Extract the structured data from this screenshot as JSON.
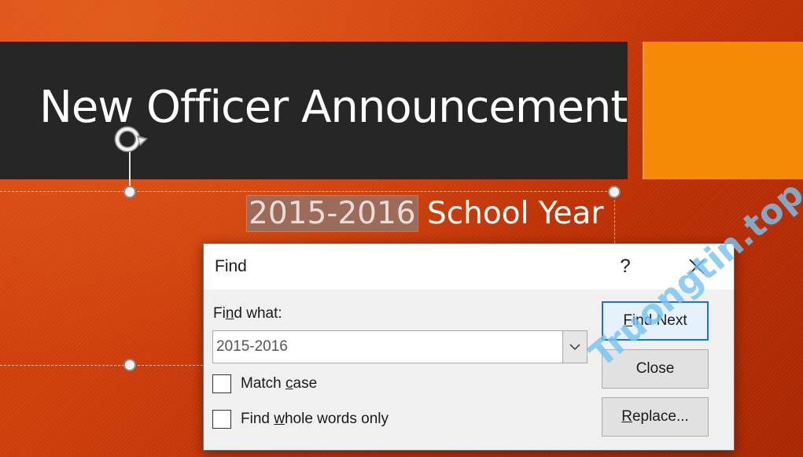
{
  "slide": {
    "title": "New Officer Announcement",
    "subtitle_highlight": "2015-2016",
    "subtitle_rest": " School Year",
    "colors": {
      "background": "#cf3f0c",
      "title_bar": "#262626",
      "accent_block": "#f58a07"
    }
  },
  "dialog": {
    "title": "Find",
    "help_label": "?",
    "close_icon": "close-icon",
    "find_what_label_pre": "Fi",
    "find_what_label_mnemonic": "n",
    "find_what_label_post": "d what:",
    "find_what_value": "2015-2016",
    "dropdown_icon": "chevron-down-icon",
    "match_case_pre": "Match ",
    "match_case_mnemonic": "c",
    "match_case_post": "ase",
    "match_case_checked": false,
    "whole_words_pre": "Find ",
    "whole_words_mnemonic": "w",
    "whole_words_post": "hole words only",
    "whole_words_checked": false,
    "buttons": {
      "find_next_mnemonic": "F",
      "find_next_rest": "ind Next",
      "close_label": "Close",
      "replace_mnemonic": "R",
      "replace_rest": "eplace..."
    },
    "colors": {
      "default_button_border": "#1a73d6"
    }
  },
  "watermark": {
    "text": "Truongtin.top"
  }
}
